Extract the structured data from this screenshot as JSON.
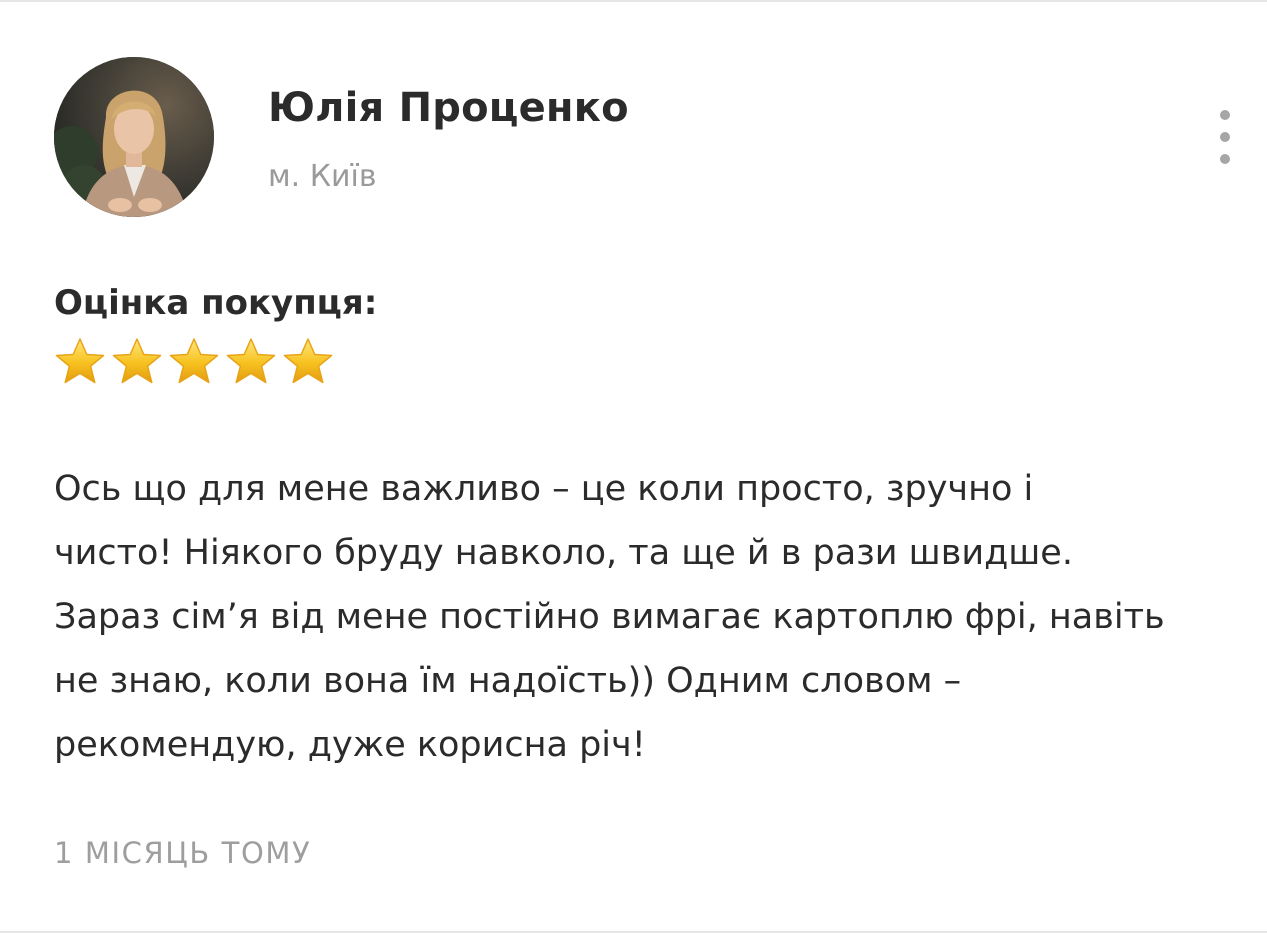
{
  "review": {
    "author": {
      "name": "Юлія Проценко",
      "city": "м. Київ",
      "avatar_icon": "user-photo"
    },
    "rating_label": "Оцінка покупця:",
    "rating": {
      "value": 5,
      "max": 5,
      "star_color": "#f7c21f"
    },
    "text_lines": [
      "Ось що для мене важливо – це коли просто, зручно і",
      "чисто! Ніякого бруду навколо, та ще й в рази швидше.",
      "Зараз сім’я від мене постійно вимагає картоплю фрі, навіть",
      "не знаю, коли вона їм надоїсть)) Одним словом –",
      "рекомендую, дуже корисна річ!"
    ],
    "date": "1 МІСЯЦЬ ТОМУ",
    "menu_icon": "more-vertical-icon"
  }
}
